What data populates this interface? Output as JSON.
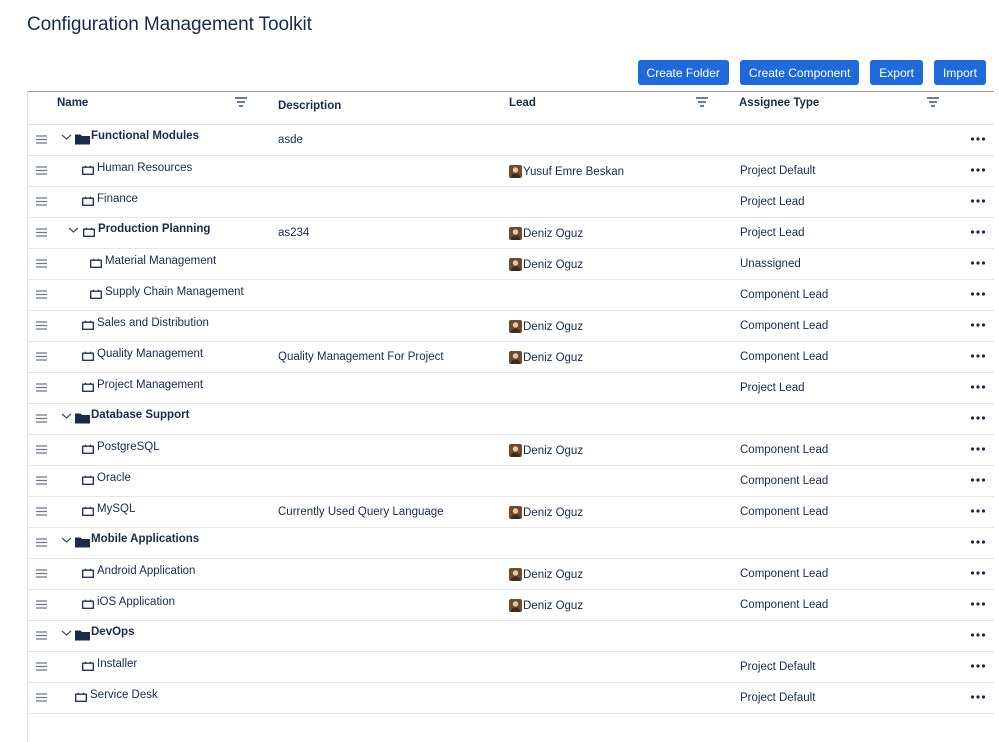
{
  "page": {
    "title": "Configuration Management Toolkit"
  },
  "toolbar": {
    "create_folder": "Create Folder",
    "create_component": "Create Component",
    "export": "Export",
    "import": "Import"
  },
  "columns": {
    "name": "Name",
    "description": "Description",
    "lead": "Lead",
    "assignee_type": "Assignee Type"
  },
  "rows": [
    {
      "name": "Functional Modules",
      "type": "folder",
      "level": 0,
      "expanded": true,
      "description": "asde",
      "lead": "",
      "assignee_type": ""
    },
    {
      "name": "Human Resources",
      "type": "component",
      "level": 1,
      "description": "",
      "lead": "Yusuf Emre Beskan",
      "assignee_type": "Project Default"
    },
    {
      "name": "Finance",
      "type": "component",
      "level": 1,
      "description": "",
      "lead": "",
      "assignee_type": "Project Lead"
    },
    {
      "name": "Production Planning",
      "type": "component",
      "level": 1,
      "expanded": true,
      "description": "as234",
      "lead": "Deniz Oguz",
      "assignee_type": "Project Lead"
    },
    {
      "name": "Material Management",
      "type": "component",
      "level": 2,
      "description": "",
      "lead": "Deniz Oguz",
      "assignee_type": "Unassigned"
    },
    {
      "name": "Supply Chain Management",
      "type": "component",
      "level": 2,
      "description": "",
      "lead": "",
      "assignee_type": "Component Lead"
    },
    {
      "name": "Sales and Distribution",
      "type": "component",
      "level": 1,
      "description": "",
      "lead": "Deniz Oguz",
      "assignee_type": "Component Lead"
    },
    {
      "name": "Quality Management",
      "type": "component",
      "level": 1,
      "description": "Quality Management For Project",
      "lead": "Deniz Oguz",
      "assignee_type": "Component Lead"
    },
    {
      "name": "Project Management",
      "type": "component",
      "level": 1,
      "description": "",
      "lead": "",
      "assignee_type": "Project Lead"
    },
    {
      "name": "Database Support",
      "type": "folder",
      "level": 0,
      "expanded": true,
      "description": "",
      "lead": "",
      "assignee_type": ""
    },
    {
      "name": "PostgreSQL",
      "type": "component",
      "level": 1,
      "description": "",
      "lead": "Deniz Oguz",
      "assignee_type": "Component Lead"
    },
    {
      "name": "Oracle",
      "type": "component",
      "level": 1,
      "description": "",
      "lead": "",
      "assignee_type": "Component Lead"
    },
    {
      "name": "MySQL",
      "type": "component",
      "level": 1,
      "description": "Currently Used Query Language",
      "lead": "Deniz Oguz",
      "assignee_type": "Component Lead"
    },
    {
      "name": "Mobile Applications",
      "type": "folder",
      "level": 0,
      "expanded": true,
      "description": "",
      "lead": "",
      "assignee_type": ""
    },
    {
      "name": "Android Application",
      "type": "component",
      "level": 1,
      "description": "",
      "lead": "Deniz Oguz",
      "assignee_type": "Component Lead"
    },
    {
      "name": "iOS Application",
      "type": "component",
      "level": 1,
      "description": "",
      "lead": "Deniz Oguz",
      "assignee_type": "Component Lead"
    },
    {
      "name": "DevOps",
      "type": "folder",
      "level": 0,
      "expanded": true,
      "description": "",
      "lead": "",
      "assignee_type": ""
    },
    {
      "name": "Installer",
      "type": "component",
      "level": 1,
      "description": "",
      "lead": "",
      "assignee_type": "Project Default"
    },
    {
      "name": "Service Desk",
      "type": "component",
      "level": -1,
      "description": "",
      "lead": "",
      "assignee_type": "Project Default"
    }
  ],
  "icons": {
    "drag": "drag-handle-icon",
    "chevron": "chevron-down-icon",
    "folder": "folder-icon",
    "component": "component-icon",
    "filter": "filter-icon",
    "more": "more-options-icon"
  },
  "colors": {
    "accent": "#1f6ad8",
    "text": "#172b4d"
  }
}
